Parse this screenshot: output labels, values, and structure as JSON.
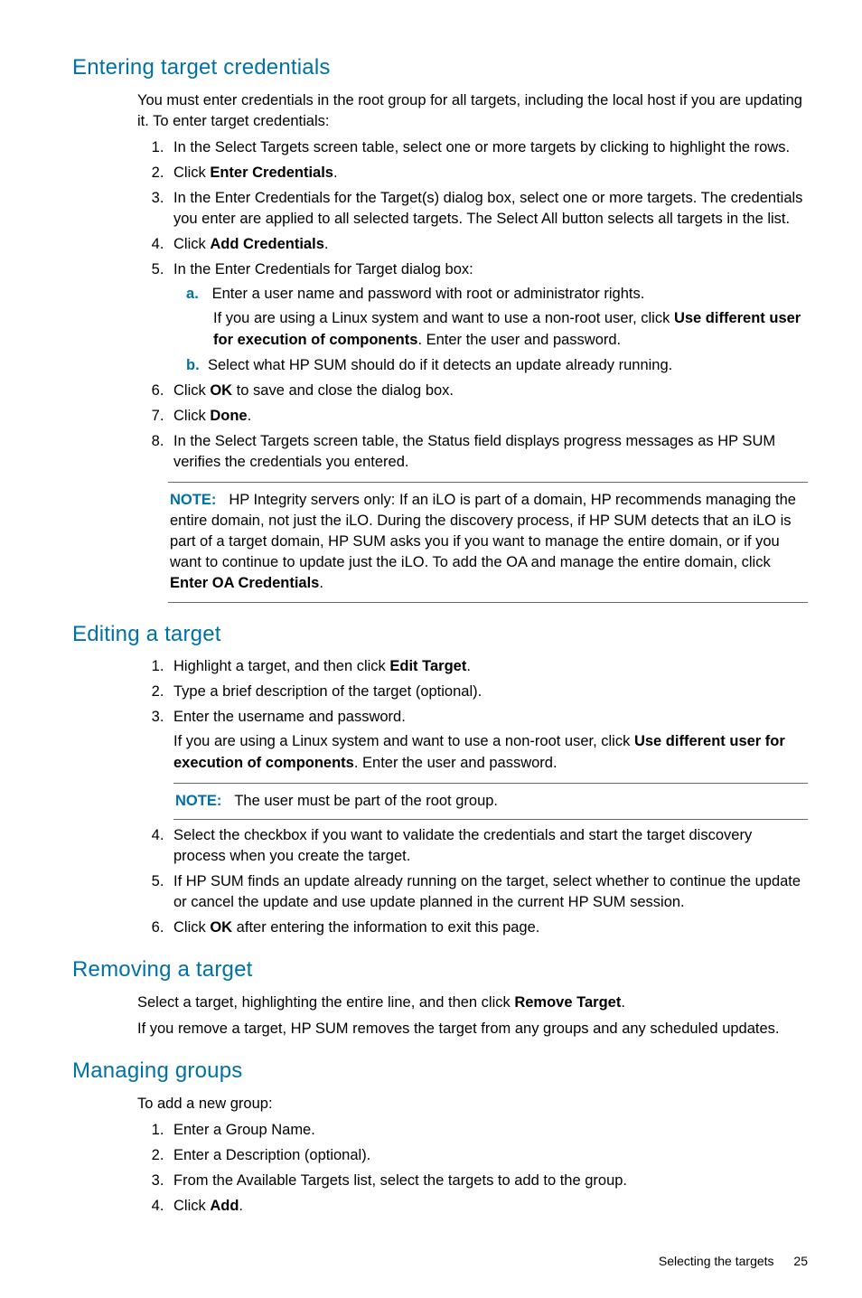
{
  "sections": {
    "s1": {
      "heading": "Entering target credentials",
      "intro": "You must enter credentials in the root group for all targets, including the local host if you are updating it. To enter target credentials:",
      "steps": {
        "i1": "In the Select Targets screen table, select one or more targets by clicking to highlight the rows.",
        "i2_pre": "Click ",
        "i2_b": "Enter Credentials",
        "i2_post": ".",
        "i3": "In the Enter Credentials for the Target(s) dialog box, select one or more targets. The credentials you enter are applied to all selected targets. The Select All button selects all targets in the list.",
        "i4_pre": "Click ",
        "i4_b": "Add Credentials",
        "i4_post": ".",
        "i5": "In the Enter Credentials for Target dialog box:",
        "i5a": "Enter a user name and password with root or administrator rights.",
        "i5a_extra_pre": "If you are using a Linux system and want to use a non-root user, click ",
        "i5a_extra_b": "Use different user for execution of components",
        "i5a_extra_post": ". Enter the user and password.",
        "i5b": "Select what HP SUM should do if it detects an update already running.",
        "i6_pre": "Click ",
        "i6_b": "OK",
        "i6_post": " to save and close the dialog box.",
        "i7_pre": "Click ",
        "i7_b": "Done",
        "i7_post": ".",
        "i8": "In the Select Targets screen table, the Status field displays progress messages as HP SUM verifies the credentials you entered."
      },
      "note_label": "NOTE:",
      "note_pre": "HP Integrity servers only: If an iLO is part of a domain, HP recommends managing the entire domain, not just the iLO. During the discovery process, if HP SUM detects that an iLO is part of a target domain, HP SUM asks you if you want to manage the entire domain, or if you want to continue to update just the iLO. To add the OA and manage the entire domain, click ",
      "note_b": "Enter OA Credentials",
      "note_post": "."
    },
    "s2": {
      "heading": "Editing a target",
      "steps": {
        "i1_pre": "Highlight a target, and then click ",
        "i1_b": "Edit Target",
        "i1_post": ".",
        "i2": "Type a brief description of the target (optional).",
        "i3": "Enter the username and password.",
        "i3_extra_pre": "If you are using a Linux system and want to use a non-root user, click ",
        "i3_extra_b": "Use different user for execution of components",
        "i3_extra_post": ". Enter the user and password.",
        "i4": "Select the checkbox if you want to validate the credentials and start the target discovery process when you create the target.",
        "i5": "If HP SUM finds an update already running on the target, select whether to continue the update or cancel the update and use update planned in the current HP SUM session.",
        "i6_pre": "Click ",
        "i6_b": "OK",
        "i6_post": " after entering the information to exit this page."
      },
      "note_label": "NOTE:",
      "note_text": "The user must be part of the root group."
    },
    "s3": {
      "heading": "Removing a target",
      "p1_pre": "Select a target, highlighting the entire line, and then click ",
      "p1_b": "Remove Target",
      "p1_post": ".",
      "p2": "If you remove a target, HP SUM removes the target from any groups and any scheduled updates."
    },
    "s4": {
      "heading": "Managing groups",
      "intro": "To add a new group:",
      "steps": {
        "i1": "Enter a Group Name.",
        "i2": "Enter a Description (optional).",
        "i3": "From the Available Targets list, select the targets to add to the group.",
        "i4_pre": "Click ",
        "i4_b": "Add",
        "i4_post": "."
      }
    }
  },
  "footer": {
    "title": "Selecting the targets",
    "page": "25"
  }
}
